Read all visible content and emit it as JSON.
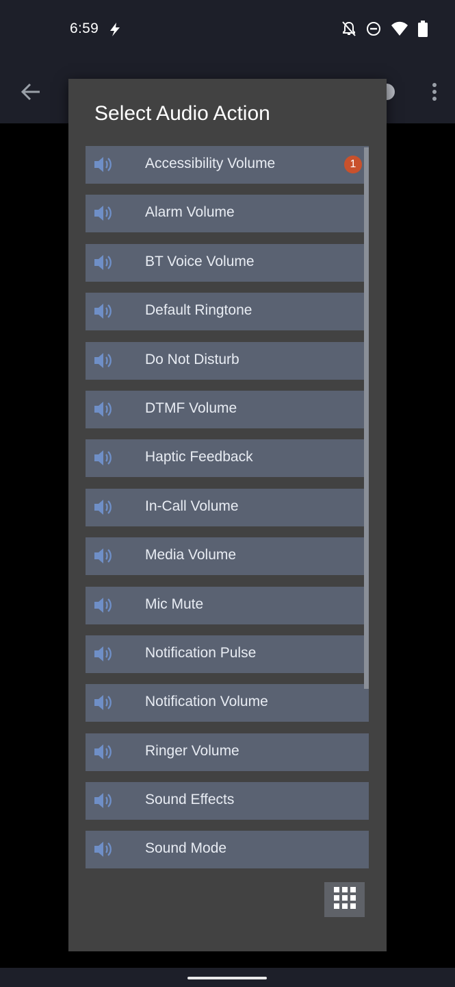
{
  "status_bar": {
    "time": "6:59",
    "icons": [
      "bolt-icon",
      "notifications-off-icon",
      "do-not-disturb-icon",
      "wifi-icon",
      "battery-icon"
    ]
  },
  "app_bar": {
    "icons": [
      "back-arrow-icon",
      "more-vert-icon"
    ]
  },
  "dialog": {
    "title": "Select Audio Action",
    "items": [
      {
        "label": "Accessibility Volume",
        "badge": "1"
      },
      {
        "label": "Alarm Volume"
      },
      {
        "label": "BT Voice Volume"
      },
      {
        "label": "Default Ringtone"
      },
      {
        "label": "Do Not Disturb"
      },
      {
        "label": "DTMF Volume"
      },
      {
        "label": "Haptic Feedback"
      },
      {
        "label": "In-Call Volume"
      },
      {
        "label": "Media Volume"
      },
      {
        "label": "Mic Mute"
      },
      {
        "label": "Notification Pulse"
      },
      {
        "label": "Notification Volume"
      },
      {
        "label": "Ringer Volume"
      },
      {
        "label": "Sound Effects"
      },
      {
        "label": "Sound Mode"
      }
    ],
    "item_icon": "speaker-icon",
    "grid_button_icon": "grid-icon"
  },
  "colors": {
    "status_bg": "#1d1f29",
    "dialog_bg": "#424242",
    "item_bg": "#5a6272",
    "speaker": "#6f8fc7",
    "badge": "#c9512c"
  }
}
